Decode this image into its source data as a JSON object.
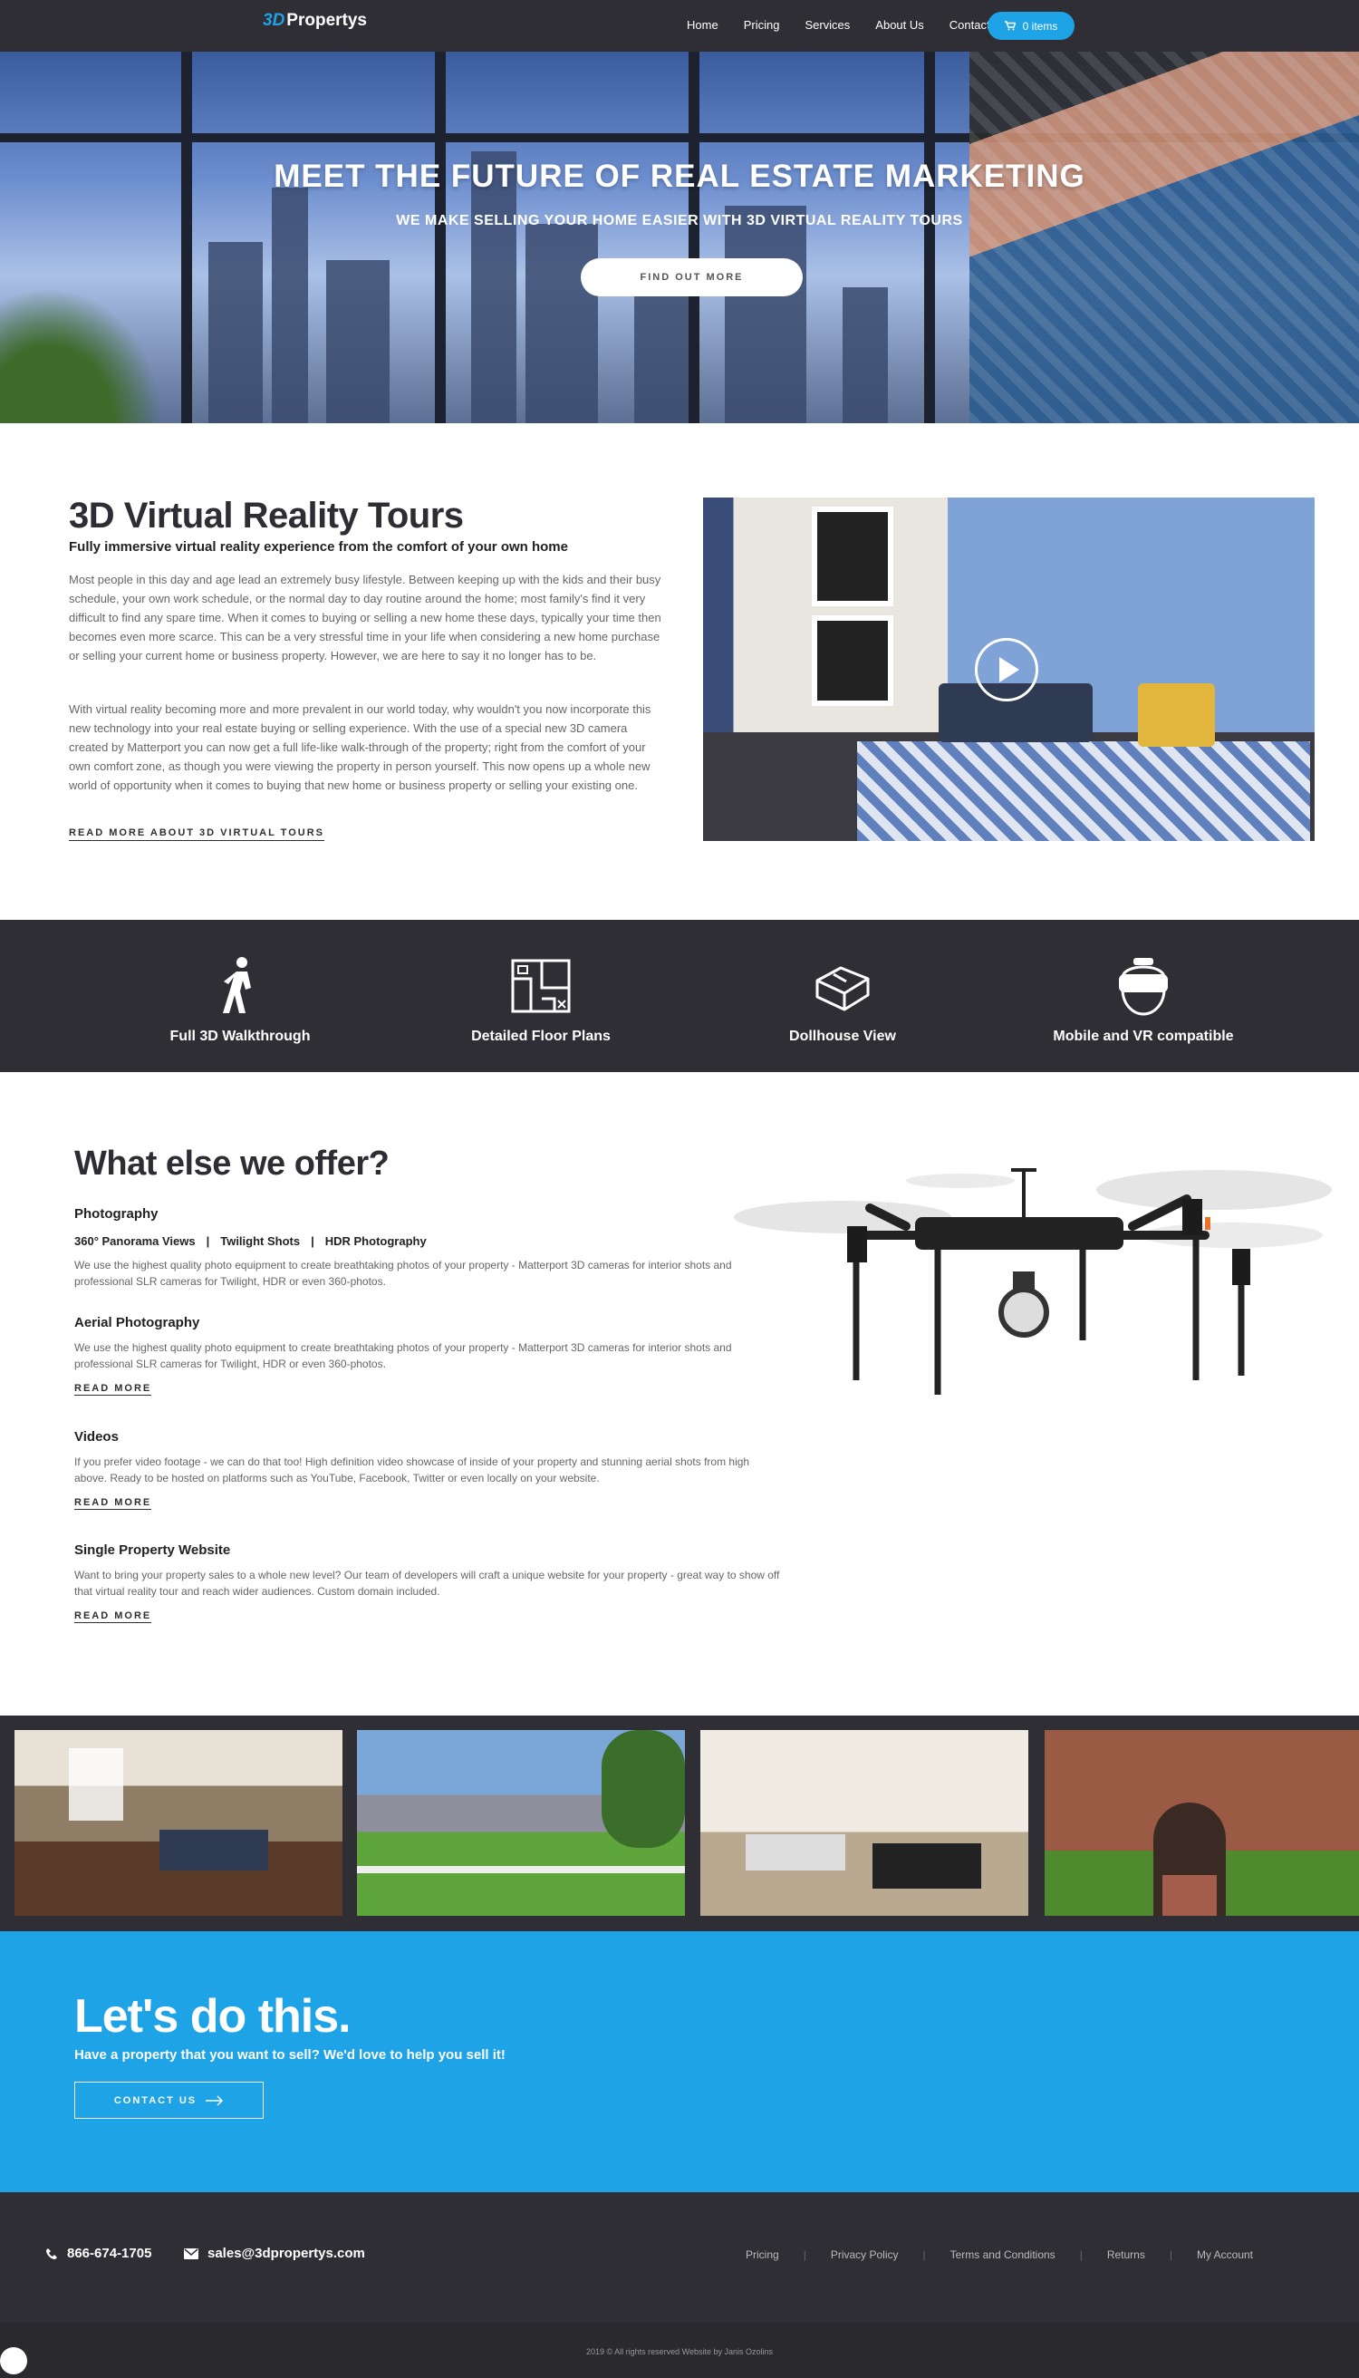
{
  "header": {
    "logo_prefix": "3D",
    "logo_text": "Propertys",
    "menu": [
      "Home",
      "Pricing",
      "Services",
      "About Us",
      "Contact"
    ],
    "cart_label": "0 items"
  },
  "hero": {
    "title": "MEET THE FUTURE OF REAL ESTATE MARKETING",
    "subtitle": "WE MAKE SELLING YOUR HOME EASIER WITH 3D VIRTUAL REALITY TOURS",
    "button": "FIND OUT MORE"
  },
  "vr": {
    "title": "3D Virtual Reality Tours",
    "subtitle": "Fully immersive virtual reality experience from the comfort of your own home",
    "para1": "Most people in this day and age lead an extremely busy lifestyle. Between keeping up with the kids and their busy schedule, your own work schedule, or the normal day to day routine around the home; most family's find it very difficult to find any spare time. When it comes to buying or selling a new home these days, typically your time then becomes even more scarce. This can be a very stressful time in your life when considering a new home purchase or selling your current home or business property. However, we are here to say it no longer has to be.",
    "para2": "With virtual reality becoming more and more prevalent in our world today, why wouldn't you now incorporate this new technology into your real estate buying or selling experience. With the use of a special new 3D camera created by Matterport you can now get a full life-like walk-through of the property; right from the comfort of your own comfort zone, as though you were viewing the property in person yourself. This now opens up a whole new world of opportunity when it comes to buying that new home or business property or selling your existing one.",
    "read_more": "READ MORE ABOUT 3D VIRTUAL TOURS"
  },
  "features": [
    {
      "label": "Full 3D Walkthrough",
      "icon": "walking-person-icon"
    },
    {
      "label": "Detailed Floor Plans",
      "icon": "floor-plan-icon"
    },
    {
      "label": "Dollhouse View",
      "icon": "dollhouse-icon"
    },
    {
      "label": "Mobile and VR compatible",
      "icon": "vr-headset-icon"
    }
  ],
  "offer": {
    "title": "What else we offer?",
    "photography": {
      "title": "Photography",
      "tags": [
        "360° Panorama Views",
        "|",
        "Twilight Shots",
        "|",
        "HDR Photography"
      ],
      "text": "We use the highest quality photo equipment to create breathtaking photos of your property - Matterport 3D cameras for interior shots and professional SLR cameras for Twilight, HDR or even 360-photos."
    },
    "aerial": {
      "title": "Aerial Photography",
      "text": "We use the highest quality photo equipment to create breathtaking photos of your property - Matterport 3D cameras for interior shots and professional SLR cameras for Twilight, HDR or even 360-photos.",
      "read_more": "READ MORE"
    },
    "videos": {
      "title": "Videos",
      "text": "If you prefer video footage - we can do that too! High definition video showcase of inside of your property and stunning aerial shots from high above. Ready to be hosted on platforms such as YouTube, Facebook, Twitter or even locally on your website.",
      "read_more": "READ MORE"
    },
    "website": {
      "title": "Single Property Website",
      "text": "Want to bring your property sales to a whole new level? Our team of developers will craft a unique website for your property - great way to show off that virtual reality tour and reach wider audiences. Custom domain included.",
      "read_more": "READ MORE"
    }
  },
  "cta": {
    "title": "Let's do this.",
    "subtitle": "Have a property that you want to sell? We'd love to help you sell it!",
    "button": "CONTACT US"
  },
  "footer": {
    "phone": "866-674-1705",
    "email": "sales@3dpropertys.com",
    "links": [
      "Pricing",
      "Privacy Policy",
      "Terms and Conditions",
      "Returns",
      "My Account"
    ],
    "copyright": "2019 © All rights reserved Website by Janis Ozolins"
  },
  "colors": {
    "brand": "#1ea3e6",
    "dark": "#2f2e34",
    "text": "#333333"
  }
}
